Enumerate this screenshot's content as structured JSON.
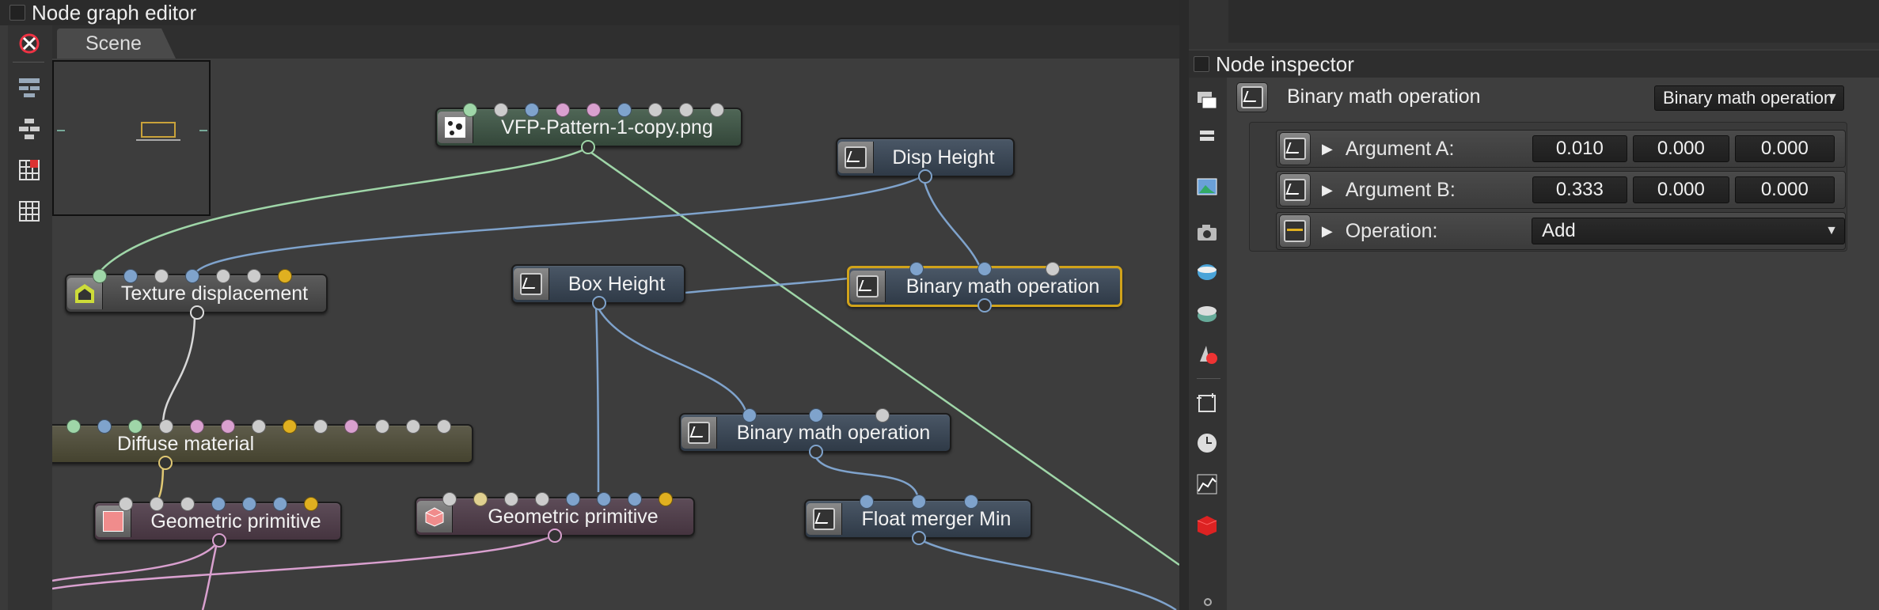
{
  "graph_editor": {
    "title": "Node graph editor",
    "tab": "Scene"
  },
  "nodes": {
    "vfp": "VFP-Pattern-1-copy.png",
    "disp_height": "Disp Height",
    "texture_disp": "Texture displacement",
    "box_height": "Box Height",
    "binary_math_selected": "Binary math operation",
    "diffuse": "Diffuse material",
    "binary_math_2": "Binary math operation",
    "geo_prim_1": "Geometric primitive",
    "geo_prim_2": "Geometric primitive",
    "float_merger": "Float merger Min"
  },
  "inspector": {
    "title": "Node inspector",
    "node_name": "Binary math operation",
    "node_type_dropdown": "Binary math operation",
    "rows": [
      {
        "label": "Argument A:",
        "values": [
          "0.010",
          "0.000",
          "0.000"
        ]
      },
      {
        "label": "Argument B:",
        "values": [
          "0.333",
          "0.000",
          "0.000"
        ]
      },
      {
        "label": "Operation:",
        "dropdown": "Add"
      }
    ]
  },
  "colors": {
    "selected_outline": "#d1a31a",
    "wire_green": "#9fd6a8",
    "wire_blue": "#7fa3cc",
    "wire_pink": "#d9a0cf",
    "wire_white": "#d8d8d8",
    "wire_yellow": "#e0c873"
  }
}
